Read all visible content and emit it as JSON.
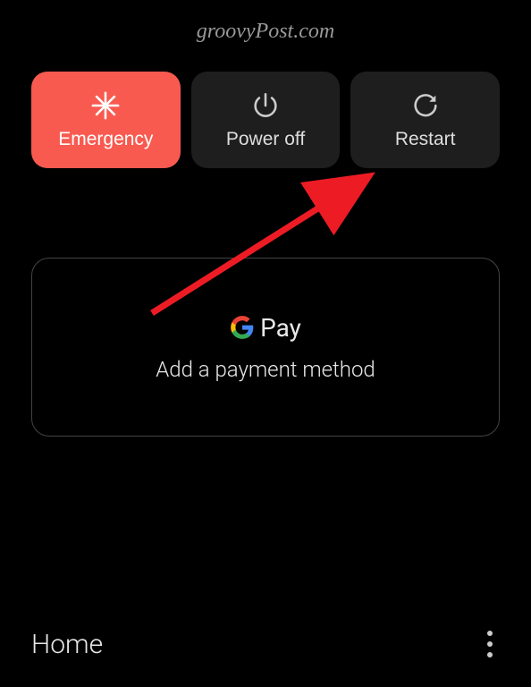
{
  "watermark": "groovyPost.com",
  "power_menu": {
    "emergency": "Emergency",
    "power_off": "Power off",
    "restart": "Restart"
  },
  "gpay": {
    "brand": "Pay",
    "subtitle": "Add a payment method"
  },
  "bottom": {
    "home": "Home"
  }
}
